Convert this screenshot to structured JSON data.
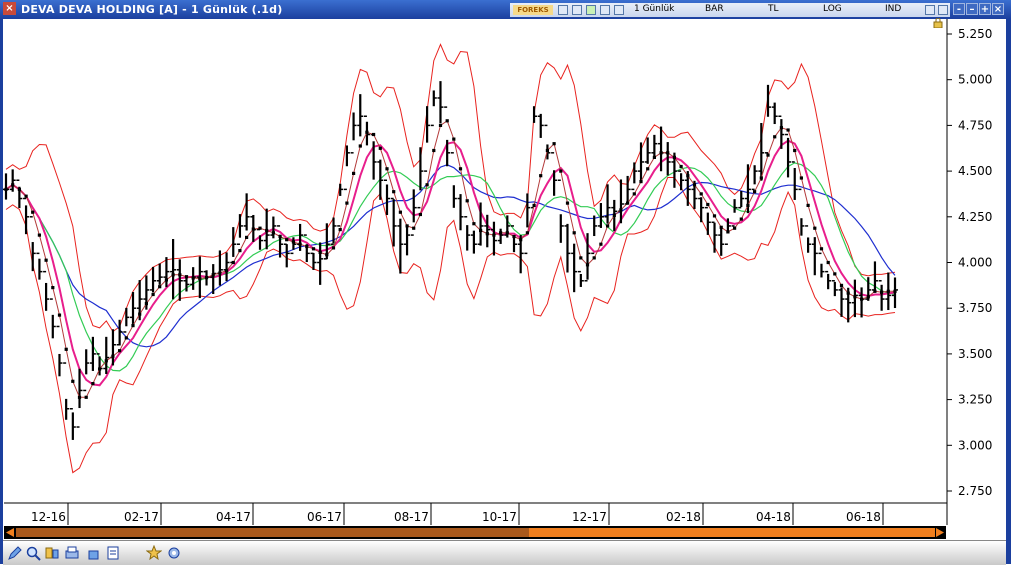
{
  "window": {
    "title": "DEVA DEVA HOLDING [A] - 1 Günlük (.1d)",
    "close_glyph": "×",
    "toolbar": {
      "logo": "FOREKS",
      "period_label": "1 Günlük",
      "type_label": "BAR",
      "currency_label": "TL",
      "scale_label": "LOG",
      "indicators_label": "IND"
    },
    "buttons": [
      "-",
      "–",
      "+",
      "×"
    ]
  },
  "chart_data": {
    "type": "bar",
    "title": "",
    "xlabel": "",
    "ylabel": "",
    "scale": "log",
    "ylim": [
      2.65,
      5.4
    ],
    "ytick_labels": [
      "5.250",
      "5.000",
      "4.750",
      "4.500",
      "4.250",
      "4.000",
      "3.750",
      "3.500",
      "3.250",
      "3.000",
      "2.750"
    ],
    "ytick_values": [
      5.25,
      5.0,
      4.75,
      4.5,
      4.25,
      4.0,
      3.75,
      3.5,
      3.25,
      3.0,
      2.75
    ],
    "xtick_labels": [
      "12-16",
      "02-17",
      "04-17",
      "06-17",
      "08-17",
      "10-17",
      "12-17",
      "02-18",
      "04-18",
      "06-18"
    ],
    "grid": false,
    "legend": "none",
    "colors": {
      "price_bars": "#000000",
      "bollinger_bands": "#e8231f",
      "ma_magenta": "#e81e8c",
      "ma_green": "#33cc55",
      "ma_blue": "#1f2fd0",
      "dotted_trend": "#000000",
      "dotted_trend_inner": "#b33a3a"
    },
    "series": [
      {
        "values": [
          4.4,
          4.45,
          4.35,
          4.25,
          4.05,
          3.95,
          3.8,
          3.65,
          3.45,
          3.2,
          3.1,
          3.3,
          3.45,
          3.5,
          3.42,
          3.48,
          3.55,
          3.62,
          3.7,
          3.75,
          3.8,
          3.85,
          3.9,
          3.92,
          3.95,
          3.96,
          3.9,
          3.88,
          3.92,
          3.95,
          3.92,
          3.94,
          3.96,
          4.0,
          4.1,
          4.2,
          4.25,
          4.18,
          4.12,
          4.15,
          4.2,
          4.1,
          4.05,
          4.1,
          4.15,
          4.05,
          4.0,
          4.02,
          4.1,
          4.2,
          4.4,
          4.6,
          4.75,
          4.8,
          4.7,
          4.55,
          4.45,
          4.35,
          4.2,
          4.1,
          4.15,
          4.3,
          4.5,
          4.75,
          4.9,
          4.85,
          4.6,
          4.35,
          4.25,
          4.15,
          4.1,
          4.2,
          4.18,
          4.12,
          4.15,
          4.2,
          4.1,
          4.05,
          4.3,
          4.8,
          4.75,
          4.6,
          4.45,
          4.2,
          4.05,
          3.95,
          3.9,
          4.05,
          4.2,
          4.25,
          4.3,
          4.28,
          4.32,
          4.4,
          4.5,
          4.55,
          4.6,
          4.65,
          4.6,
          4.55,
          4.5,
          4.45,
          4.4,
          4.35,
          4.3,
          4.22,
          4.15,
          4.1,
          4.2,
          4.3,
          4.35,
          4.4,
          4.5,
          4.6,
          4.85,
          4.8,
          4.7,
          4.55,
          4.4,
          4.2,
          4.1,
          4.05,
          3.95,
          3.9,
          3.85,
          3.8,
          3.78,
          3.82,
          3.8,
          3.85,
          3.9,
          3.8,
          3.82,
          3.85
        ]
      }
    ]
  },
  "bottom_toolbar": {
    "icons": [
      "pencil-icon",
      "zoom-icon",
      "tools-icon",
      "print-icon",
      "cube-icon",
      "document-icon",
      "star-icon",
      "settings-icon"
    ]
  }
}
